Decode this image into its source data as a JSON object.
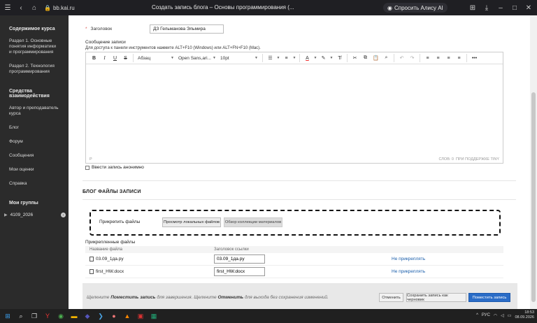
{
  "browser": {
    "url": "bb.kai.ru",
    "tab_title": "Создать запись блога – Основы программирования (...",
    "alice_label": "Спросить Алису AI"
  },
  "sidebar": {
    "content_title": "Содержимое курса",
    "sections": [
      "Раздел 1. Основные понятия информатики и программирования",
      "Раздел 2. Технология программирования"
    ],
    "tools_title": "Средства взаимодействия",
    "tools": [
      "Автор и преподаватель курса",
      "Блог",
      "Форум",
      "Сообщения",
      "Мои оценки",
      "Справка"
    ],
    "groups_title": "Мои группы",
    "group": "4109_2026"
  },
  "form": {
    "subject_label": "Заголовок",
    "subject_value": "ДЗ Гельманова Эльмира",
    "message_label": "Сообщение записи",
    "message_hint": "Для доступа к панели инструментов нажмите ALT+F10 (Windows) или ALT+FN+F10 (Mac).",
    "anonymous_label": "Ввести запись анонимно"
  },
  "toolbar": {
    "paragraph": "Абзац",
    "font": "Open Sans,ari...",
    "size": "10pt"
  },
  "editor_status": {
    "path": "P",
    "words": "СЛОВ: 0",
    "brand": "ПРИ ПОДДЕРЖКЕ TINY"
  },
  "files": {
    "section_title": "БЛОГ ФАЙЛЫ ЗАПИСИ",
    "attach_label": "Прикрепить файлы",
    "browse_local": "Просмотр локальных файлов",
    "browse_collection": "Обзор коллекции материалов",
    "attached_title": "Прикрепленные файлы",
    "col_name": "Название файла",
    "col_link": "Заголовок ссылки",
    "rows": [
      {
        "name": "03.09_1да.py",
        "link_title": "03.09_1да.py",
        "action": "Не прикреплять"
      },
      {
        "name": "first_HW.docx",
        "link_title": "first_HW.docx",
        "action": "Не прикреплять"
      }
    ]
  },
  "footer": {
    "note_1": "Щелкните ",
    "note_submit": "Поместить запись",
    "note_2": " для завершения. Щелкните ",
    "note_cancel": "Отменить",
    "note_3": " для выхода без сохранения изменений.",
    "cancel": "Отменить",
    "draft": "Сохранить запись как черновик",
    "submit": "Поместить запись"
  },
  "taskbar": {
    "lang": "РУС",
    "time": "18:53",
    "date": "08.09.2026"
  }
}
